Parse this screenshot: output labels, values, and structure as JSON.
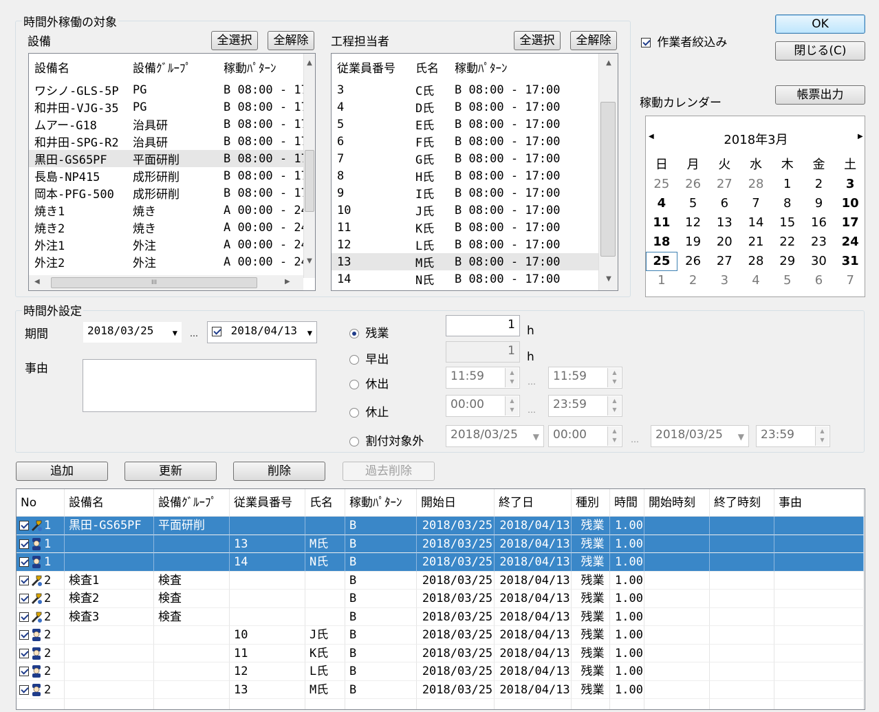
{
  "target": {
    "group_title": "時間外稼働の対象",
    "equipment": {
      "label": "設備",
      "select_all": "全選択",
      "deselect_all": "全解除",
      "columns": [
        "設備名",
        "設備ｸﾞﾙｰﾌﾟ",
        "稼動ﾊﾟﾀｰﾝ"
      ],
      "rows": [
        [
          "ワシノ-GLS-5P",
          "PG",
          "B  08:00 - 17"
        ],
        [
          "和井田-VJG-35",
          "PG",
          "B  08:00 - 17"
        ],
        [
          "ムアー-G18",
          "治具研",
          "B  08:00 - 17"
        ],
        [
          "和井田-SPG-R2",
          "治具研",
          "B  08:00 - 17"
        ],
        [
          "黒田-GS65PF",
          "平面研削",
          "B  08:00 - 17"
        ],
        [
          "長島-NP415",
          "成形研削",
          "B  08:00 - 17"
        ],
        [
          "岡本-PFG-500",
          "成形研削",
          "B  08:00 - 17"
        ],
        [
          "焼き1",
          "焼き",
          "A  00:00 - 24"
        ],
        [
          "焼き2",
          "焼き",
          "A  00:00 - 24"
        ],
        [
          "外注1",
          "外注",
          "A  00:00 - 24"
        ],
        [
          "外注2",
          "外注",
          "A  00:00 - 24"
        ]
      ],
      "hscroll_label": "III"
    },
    "workers": {
      "label": "工程担当者",
      "select_all": "全選択",
      "deselect_all": "全解除",
      "columns": [
        "従業員番号",
        "氏名",
        "稼動ﾊﾟﾀｰﾝ"
      ],
      "rows": [
        [
          "3",
          "C氏",
          "B  08:00 - 17:00"
        ],
        [
          "4",
          "D氏",
          "B  08:00 - 17:00"
        ],
        [
          "5",
          "E氏",
          "B  08:00 - 17:00"
        ],
        [
          "6",
          "F氏",
          "B  08:00 - 17:00"
        ],
        [
          "7",
          "G氏",
          "B  08:00 - 17:00"
        ],
        [
          "8",
          "H氏",
          "B  08:00 - 17:00"
        ],
        [
          "9",
          "I氏",
          "B  08:00 - 17:00"
        ],
        [
          "10",
          "J氏",
          "B  08:00 - 17:00"
        ],
        [
          "11",
          "K氏",
          "B  08:00 - 17:00"
        ],
        [
          "12",
          "L氏",
          "B  08:00 - 17:00"
        ],
        [
          "13",
          "M氏",
          "B  08:00 - 17:00"
        ],
        [
          "14",
          "N氏",
          "B  08:00 - 17:00"
        ]
      ]
    }
  },
  "right": {
    "ok": "OK",
    "close": "閉じる(C)",
    "worker_filter": "作業者絞込み",
    "calendar_label": "稼動カレンダー",
    "report": "帳票出力"
  },
  "calendar": {
    "title": "2018年3月",
    "weekdays": [
      "日",
      "月",
      "火",
      "水",
      "木",
      "金",
      "土"
    ],
    "weeks": [
      [
        "25",
        "26",
        "27",
        "28",
        "1",
        "2",
        "3"
      ],
      [
        "4",
        "5",
        "6",
        "7",
        "8",
        "9",
        "10"
      ],
      [
        "11",
        "12",
        "13",
        "14",
        "15",
        "16",
        "17"
      ],
      [
        "18",
        "19",
        "20",
        "21",
        "22",
        "23",
        "24"
      ],
      [
        "25",
        "26",
        "27",
        "28",
        "29",
        "30",
        "31"
      ],
      [
        "1",
        "2",
        "3",
        "4",
        "5",
        "6",
        "7"
      ]
    ],
    "today": "25"
  },
  "overtime": {
    "group_title": "時間外設定",
    "period_label": "期間",
    "period_start": "2018/03/25",
    "period_sep": "…",
    "period_end": "2018/04/13",
    "reason_label": "事由",
    "options": {
      "zangyo": "残業",
      "hayade": "早出",
      "kyushutsu": "休出",
      "kyushi": "休止",
      "excluded": "割付対象外"
    },
    "zangyo_hours": "1",
    "hayade_hours": "1",
    "unit_h": "h",
    "kyushutsu_from": "11:59",
    "kyushutsu_to": "11:59",
    "kyushi_from": "00:00",
    "kyushi_to": "23:59",
    "excl_date_from": "2018/03/25",
    "excl_time_from": "00:00",
    "excl_date_to": "2018/03/25",
    "excl_time_to": "23:59",
    "dots": "…"
  },
  "actions": {
    "add": "追加",
    "update": "更新",
    "delete": "削除",
    "past_delete": "過去削除"
  },
  "grid": {
    "columns": [
      "No",
      "設備名",
      "設備ｸﾞﾙｰﾌﾟ",
      "従業員番号",
      "氏名",
      "稼動ﾊﾟﾀｰﾝ",
      "開始日",
      "終了日",
      "種別",
      "時間",
      "開始時刻",
      "終了時刻",
      "事由"
    ],
    "rows": [
      {
        "icon": "tool",
        "no": "1",
        "equip": "黒田-GS65PF",
        "group": "平面研削",
        "emp": "",
        "name": "",
        "pattern": "B",
        "start": "2018/03/25",
        "end": "2018/04/13",
        "type": "残業",
        "hours": "1.00",
        "sel": true
      },
      {
        "icon": "worker",
        "no": "1",
        "equip": "",
        "group": "",
        "emp": "13",
        "name": "M氏",
        "pattern": "B",
        "start": "2018/03/25",
        "end": "2018/04/13",
        "type": "残業",
        "hours": "1.00",
        "sel": true
      },
      {
        "icon": "worker",
        "no": "1",
        "equip": "",
        "group": "",
        "emp": "14",
        "name": "N氏",
        "pattern": "B",
        "start": "2018/03/25",
        "end": "2018/04/13",
        "type": "残業",
        "hours": "1.00",
        "sel": true
      },
      {
        "icon": "tool",
        "no": "2",
        "equip": "検査1",
        "group": "検査",
        "emp": "",
        "name": "",
        "pattern": "B",
        "start": "2018/03/25",
        "end": "2018/04/13",
        "type": "残業",
        "hours": "1.00",
        "sel": false
      },
      {
        "icon": "tool",
        "no": "2",
        "equip": "検査2",
        "group": "検査",
        "emp": "",
        "name": "",
        "pattern": "B",
        "start": "2018/03/25",
        "end": "2018/04/13",
        "type": "残業",
        "hours": "1.00",
        "sel": false
      },
      {
        "icon": "tool",
        "no": "2",
        "equip": "検査3",
        "group": "検査",
        "emp": "",
        "name": "",
        "pattern": "B",
        "start": "2018/03/25",
        "end": "2018/04/13",
        "type": "残業",
        "hours": "1.00",
        "sel": false
      },
      {
        "icon": "worker",
        "no": "2",
        "equip": "",
        "group": "",
        "emp": "10",
        "name": "J氏",
        "pattern": "B",
        "start": "2018/03/25",
        "end": "2018/04/13",
        "type": "残業",
        "hours": "1.00",
        "sel": false
      },
      {
        "icon": "worker",
        "no": "2",
        "equip": "",
        "group": "",
        "emp": "11",
        "name": "K氏",
        "pattern": "B",
        "start": "2018/03/25",
        "end": "2018/04/13",
        "type": "残業",
        "hours": "1.00",
        "sel": false
      },
      {
        "icon": "worker",
        "no": "2",
        "equip": "",
        "group": "",
        "emp": "12",
        "name": "L氏",
        "pattern": "B",
        "start": "2018/03/25",
        "end": "2018/04/13",
        "type": "残業",
        "hours": "1.00",
        "sel": false
      },
      {
        "icon": "worker",
        "no": "2",
        "equip": "",
        "group": "",
        "emp": "13",
        "name": "M氏",
        "pattern": "B",
        "start": "2018/03/25",
        "end": "2018/04/13",
        "type": "残業",
        "hours": "1.00",
        "sel": false
      }
    ]
  }
}
